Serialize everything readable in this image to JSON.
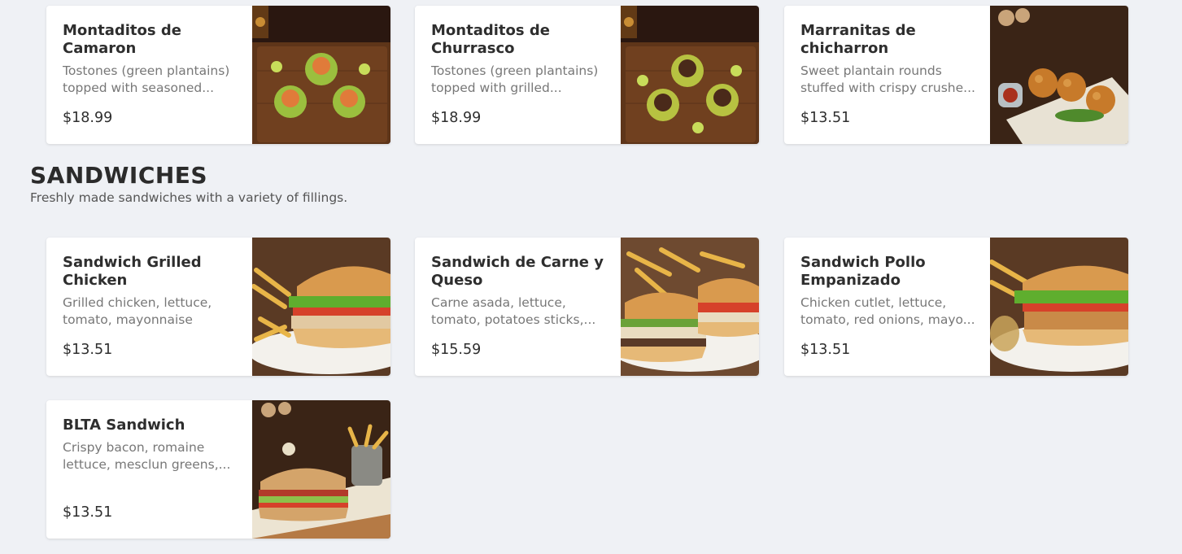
{
  "appetizers": [
    {
      "title": "Montaditos de Camaron",
      "desc": "Tostones (green plantains) topped with seasoned...",
      "price": "$18.99",
      "image": "montaditos-camaron-photo"
    },
    {
      "title": "Montaditos de Churrasco",
      "desc": "Tostones (green plantains) topped with grilled...",
      "price": "$18.99",
      "image": "montaditos-churrasco-photo"
    },
    {
      "title": "Marranitas de chicharron",
      "desc": "Sweet plantain rounds stuffed with crispy crushe...",
      "price": "$13.51",
      "image": "marranitas-photo"
    }
  ],
  "sandwiches_section": {
    "title": "SANDWICHES",
    "description": "Freshly made sandwiches with a variety of fillings.",
    "items": [
      {
        "title": "Sandwich Grilled Chicken",
        "desc": "Grilled chicken, lettuce, tomato, mayonnaise",
        "price": "$13.51",
        "image": "grilled-chicken-sandwich-photo"
      },
      {
        "title": "Sandwich de Carne y Queso",
        "desc": "Carne asada, lettuce, tomato, potatoes sticks,...",
        "price": "$15.59",
        "image": "carne-queso-sandwich-photo"
      },
      {
        "title": "Sandwich Pollo Empanizado",
        "desc": "Chicken cutlet, lettuce, tomato, red onions, mayo...",
        "price": "$13.51",
        "image": "pollo-empanizado-sandwich-photo"
      },
      {
        "title": "BLTA Sandwich",
        "desc": "Crispy bacon, romaine lettuce, mesclun greens,...",
        "price": "$13.51",
        "image": "blta-sandwich-photo"
      }
    ]
  },
  "colors": {
    "background": "#eff1f5",
    "card": "#ffffff",
    "wood_dark": "#3a2314",
    "wood": "#6b3f22",
    "plate": "#f3f1ec"
  }
}
